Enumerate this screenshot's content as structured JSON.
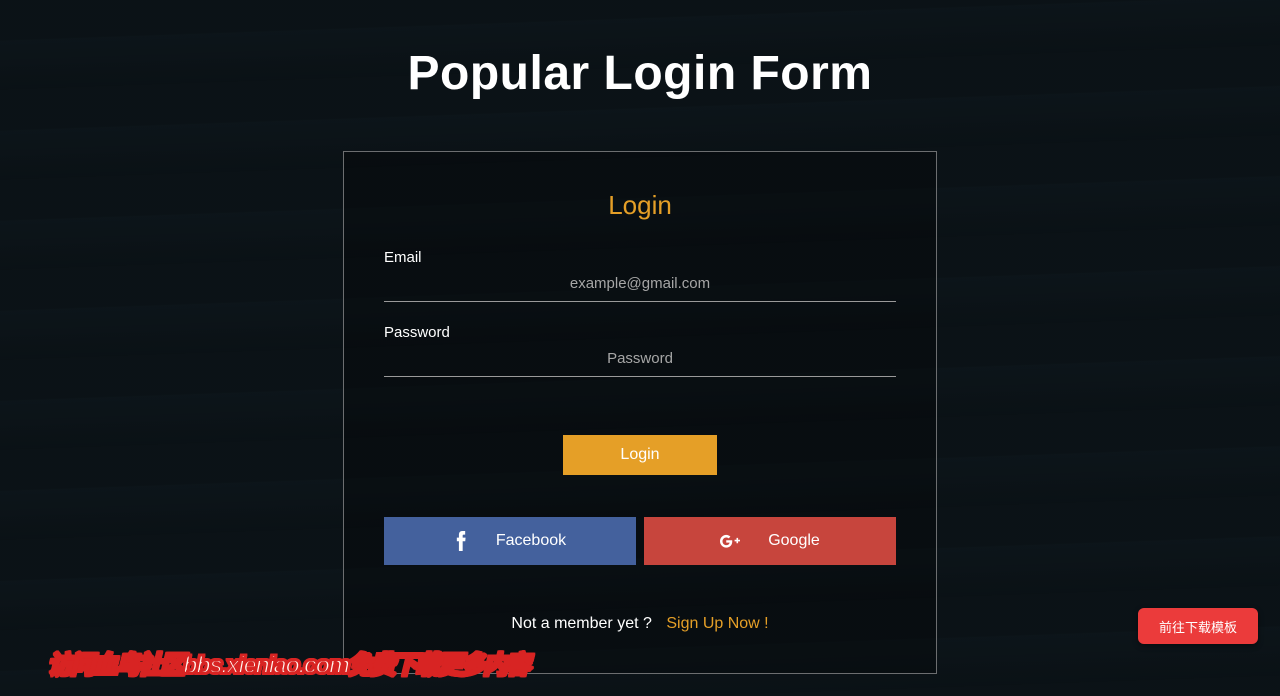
{
  "page": {
    "title": "Popular Login Form"
  },
  "card": {
    "heading": "Login"
  },
  "form": {
    "email_label": "Email",
    "email_placeholder": "example@gmail.com",
    "password_label": "Password",
    "password_placeholder": "Password",
    "submit_label": "Login"
  },
  "social": {
    "facebook_label": "Facebook",
    "google_label": "Google"
  },
  "footer": {
    "prompt": "Not a member yet ?",
    "signup_label": "Sign Up Now !"
  },
  "floating": {
    "download_label": "前往下载模板"
  },
  "watermark": {
    "text": "访问血鸟社区bbs.xieniao.com免费下载更多内容"
  },
  "colors": {
    "accent": "#e59f27",
    "facebook": "#44619d",
    "google": "#c7453d",
    "download": "#eb3b3b"
  }
}
